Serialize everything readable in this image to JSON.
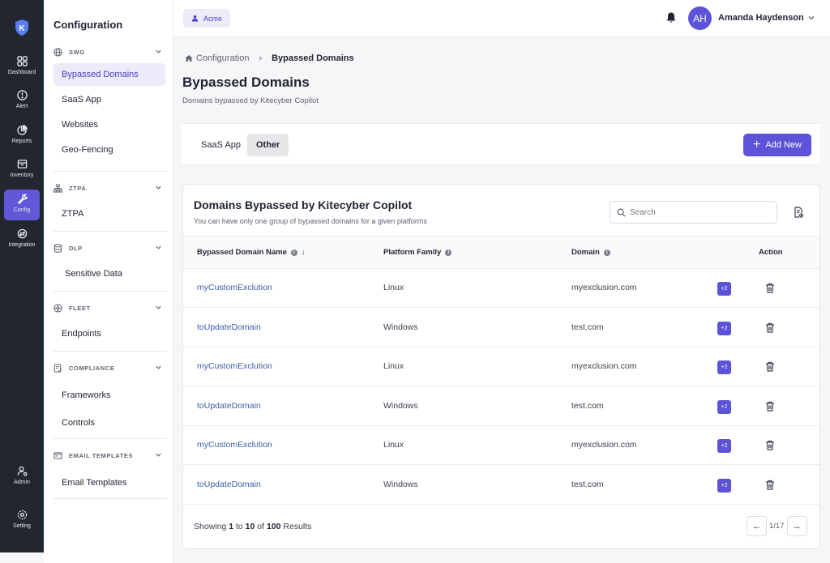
{
  "rail": {
    "items": [
      {
        "label": "Dashboard",
        "icon": "grid-icon"
      },
      {
        "label": "Alert",
        "icon": "alert-icon"
      },
      {
        "label": "Reports",
        "icon": "pie-chart-icon"
      },
      {
        "label": "Inventory",
        "icon": "inventory-icon"
      },
      {
        "label": "Config",
        "icon": "wrench-icon"
      },
      {
        "label": "Integration",
        "icon": "integration-icon"
      }
    ],
    "bottom": [
      {
        "label": "Admin",
        "icon": "admin-icon"
      },
      {
        "label": "Setting",
        "icon": "gear-icon"
      }
    ],
    "active_label": "Config"
  },
  "sidebar": {
    "title": "Configuration",
    "sections": [
      {
        "name": "SWG",
        "items": [
          "Bypassed Domains",
          "SaaS App",
          "Websites",
          "Geo-Fencing"
        ]
      },
      {
        "name": "ZTPA",
        "items": [
          "ZTPA"
        ]
      },
      {
        "name": "DLP",
        "items": [
          "Sensitive Data"
        ]
      },
      {
        "name": "FLEET",
        "items": [
          "Endpoints"
        ]
      },
      {
        "name": "COMPLIANCE",
        "items": [
          "Frameworks",
          "Controls"
        ]
      },
      {
        "name": "EMAIL TEMPLATES",
        "items": [
          "Email Templates"
        ]
      }
    ],
    "active_item": "Bypassed Domains"
  },
  "topbar": {
    "org": "Acme",
    "avatar_initials": "AH",
    "user_name": "Amanda Haydenson"
  },
  "breadcrumb": {
    "root": "Configuration",
    "current": "Bypassed Domains"
  },
  "page": {
    "title": "Bypassed Domains",
    "subtitle": "Domains bypassed by Kitecyber Copilot"
  },
  "tabs": [
    {
      "label": "SaaS App"
    },
    {
      "label": "Other"
    }
  ],
  "active_tab": "Other",
  "add_button": "Add New",
  "card": {
    "title": "Domains Bypassed by Kitecyber Copilot",
    "subtitle": "You can have only one group of bypassed domains for a given platforms",
    "search_placeholder": "Search"
  },
  "table": {
    "columns": [
      "Bypassed Domain Name",
      "Platform Family",
      "Domain",
      "Action"
    ],
    "rows": [
      {
        "name": "myCustomExclution",
        "platform": "Linux",
        "domain": "myexclusion.com",
        "badge": "+2"
      },
      {
        "name": "toUpdateDomain",
        "platform": "Windows",
        "domain": "test.com",
        "badge": "+2"
      },
      {
        "name": "myCustomExclution",
        "platform": "Linux",
        "domain": "myexclusion.com",
        "badge": "+2"
      },
      {
        "name": "toUpdateDomain",
        "platform": "Windows",
        "domain": "test.com",
        "badge": "+2"
      },
      {
        "name": "myCustomExclution",
        "platform": "Linux",
        "domain": "myexclusion.com",
        "badge": "+2"
      },
      {
        "name": "toUpdateDomain",
        "platform": "Windows",
        "domain": "test.com",
        "badge": "+2"
      }
    ]
  },
  "footer": {
    "showing_prefix": "Showing",
    "from": "1",
    "to_word": "to",
    "to": "10",
    "of_word": "of",
    "total": "100",
    "suffix": "Results",
    "page_indicator": "1/17",
    "prev": "←",
    "next": "→"
  },
  "colors": {
    "accent": "#5d53d8",
    "rail_bg": "#22262e",
    "link": "#3b5fa8"
  }
}
